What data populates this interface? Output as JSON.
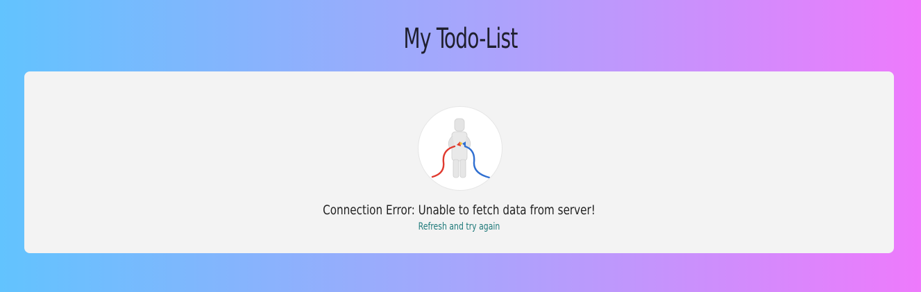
{
  "header": {
    "title": "My Todo-List"
  },
  "error_card": {
    "illustration_icon": "unplugged-cable-person-icon",
    "message": "Connection Error: Unable to fetch data from server!",
    "retry_link": "Refresh and try again"
  },
  "colors": {
    "gradient_start": "#62c3fe",
    "gradient_mid": "#a6a6fc",
    "gradient_end": "#ee7afc",
    "card_background": "#f3f3f3",
    "link": "#1f7a7a",
    "title_text": "#1f1f2e"
  }
}
